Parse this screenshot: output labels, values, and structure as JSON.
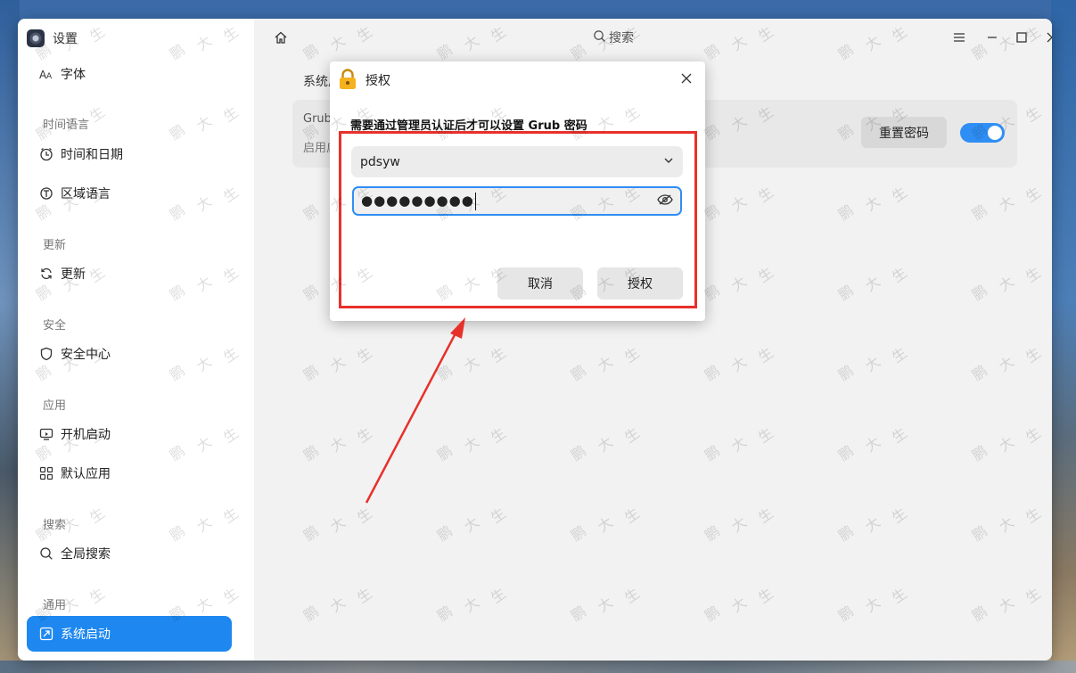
{
  "window": {
    "app_title": "设置",
    "search_placeholder": "搜索"
  },
  "sidebar": {
    "font_item": "字体",
    "sections": {
      "time_lang": "时间语言",
      "update": "更新",
      "security": "安全",
      "apps": "应用",
      "search": "搜索",
      "general": "通用"
    },
    "items": {
      "datetime": "时间和日期",
      "region": "区域语言",
      "update": "更新",
      "security_center": "安全中心",
      "autostart": "开机启动",
      "default_apps": "默认应用",
      "global_search": "全局搜索",
      "boot": "系统启动"
    }
  },
  "main": {
    "breadcrumb": "系统启",
    "card_line1": "Grub",
    "card_line2": "启用启",
    "reset_password_label": "重置密码",
    "toggle_on": true
  },
  "dialog": {
    "title": "授权",
    "message": "需要通过管理员认证后才可以设置 Grub 密码",
    "username": "pdsyw",
    "password_mask": "●●●●●●●●●",
    "cancel_label": "取消",
    "authorize_label": "授权"
  },
  "watermark": {
    "text1": "鹏",
    "text2": "大",
    "text3": "生"
  },
  "colors": {
    "accent": "#1e88f0",
    "highlight": "#e8302a"
  }
}
